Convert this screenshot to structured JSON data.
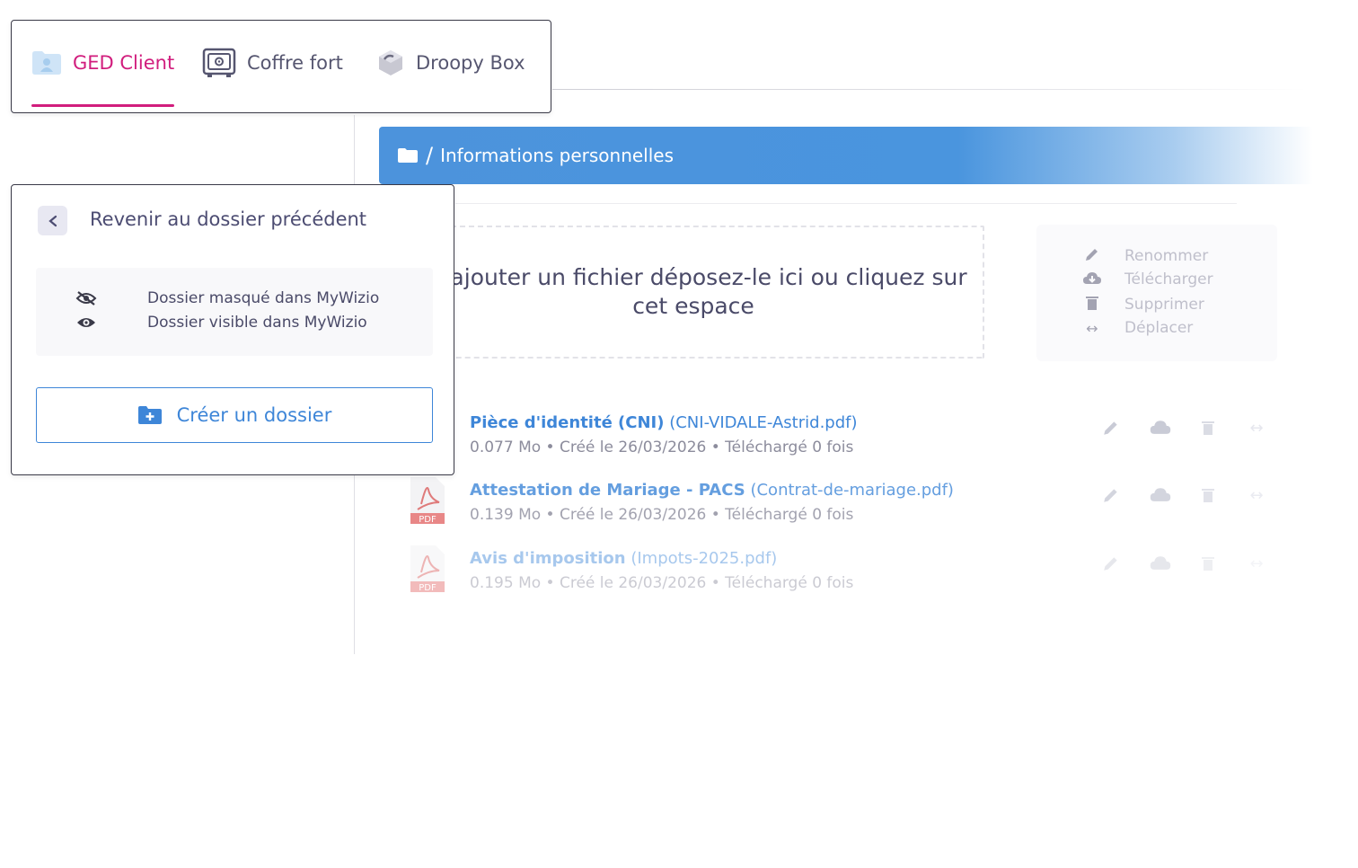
{
  "tabs": [
    {
      "label": "GED Client",
      "icon": "user-folder-icon",
      "active": true
    },
    {
      "label": "Coffre fort",
      "icon": "safe-icon",
      "active": false
    },
    {
      "label": "Droopy Box",
      "icon": "box-icon",
      "active": false
    }
  ],
  "folder_panel": {
    "back_label": "Revenir au dossier précédent",
    "legend": [
      {
        "icon": "eye-slash-icon",
        "text": "Dossier masqué dans MyWizio"
      },
      {
        "icon": "eye-icon",
        "text": "Dossier visible dans MyWizio"
      }
    ],
    "create_label": "Créer un dossier"
  },
  "breadcrumb": {
    "separator": "/",
    "title": "Informations personnelles"
  },
  "dropzone": {
    "text": "ur ajouter un fichier déposez-le ici ou cliquez sur cet espace"
  },
  "actions_legend": [
    {
      "icon": "pencil-icon",
      "label": "Renommer"
    },
    {
      "icon": "cloud-download-icon",
      "label": "Télécharger"
    },
    {
      "icon": "trash-icon",
      "label": "Supprimer"
    },
    {
      "icon": "move-arrows-icon",
      "label": "Déplacer"
    }
  ],
  "files": [
    {
      "title": "Pièce d'identité (CNI)",
      "filename": "(CNI-VIDALE-Astrid.pdf)",
      "meta": "0.077 Mo • Créé le 26/03/2026 • Téléchargé 0 fois"
    },
    {
      "title": "Attestation de Mariage - PACS",
      "filename": "(Contrat-de-mariage.pdf)",
      "meta": "0.139 Mo • Créé le 26/03/2026 • Téléchargé 0 fois"
    },
    {
      "title": "Avis d'imposition",
      "filename": "(Impots-2025.pdf)",
      "meta": "0.195 Mo • Créé le 26/03/2026 • Téléchargé 0 fois"
    }
  ],
  "pdf_badge": "PDF",
  "colors": {
    "accent": "#d11d7d",
    "primary": "#3e86d8",
    "bar": "#4a95de"
  }
}
